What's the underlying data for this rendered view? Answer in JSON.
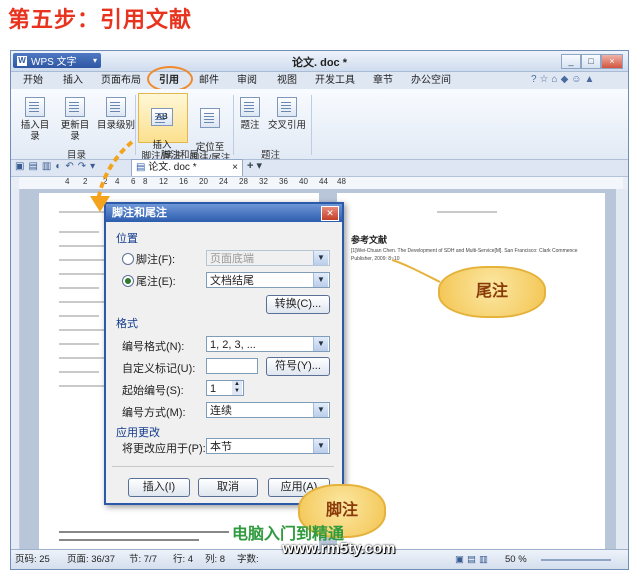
{
  "page_title": "第五步：引用文献",
  "window": {
    "app_button": "WPS 文字",
    "doc_title": "论文. doc *",
    "controls": [
      "_",
      "□",
      "×"
    ]
  },
  "menu_tabs": [
    "开始",
    "插入",
    "页面布局",
    "引用",
    "邮件",
    "审阅",
    "视图",
    "开发工具",
    "章节",
    "办公空间"
  ],
  "ribbon": {
    "buttons": [
      {
        "label": "插入目录",
        "icon": "insert-toc-icon"
      },
      {
        "label": "更新目录",
        "icon": "update-toc-icon"
      },
      {
        "label": "目录级别",
        "icon": "toc-level-icon"
      },
      {
        "label": "插入\n脚注/尾注",
        "icon": "insert-footnote-icon"
      },
      {
        "label": "定位至\n脚注/尾注",
        "icon": "goto-footnote-icon"
      },
      {
        "label": "题注",
        "icon": "caption-icon"
      },
      {
        "label": "交叉引用",
        "icon": "cross-ref-icon"
      }
    ],
    "groups": [
      "目录",
      "脚注和尾注",
      "题注"
    ]
  },
  "doc_tab": "论文. doc *",
  "ruler_ticks": [
    "4",
    "2",
    "2",
    "4",
    "6",
    "8",
    "12",
    "16",
    "20",
    "24",
    "28",
    "32",
    "36",
    "40",
    "44",
    "48"
  ],
  "page2": {
    "heading": "参考文献",
    "ref_text": "[1]Wei-Chuan Chen. The Development of SDH and Multi-Service[M]. San Francisco: Clark Commence Publisher, 2009: 8~10"
  },
  "dialog": {
    "title": "脚注和尾注",
    "section_position": "位置",
    "footnote_label": "脚注(F):",
    "footnote_value": "页面底端",
    "endnote_label": "尾注(E):",
    "endnote_value": "文档结尾",
    "convert_button": "转换(C)...",
    "section_format": "格式",
    "number_format_label": "编号格式(N):",
    "number_format_value": "1, 2, 3, ...",
    "custom_mark_label": "自定义标记(U):",
    "custom_mark_value": "",
    "symbol_button": "符号(Y)...",
    "start_at_label": "起始编号(S):",
    "start_at_value": "1",
    "numbering_label": "编号方式(M):",
    "numbering_value": "连续",
    "section_apply": "应用更改",
    "apply_to_label": "将更改应用于(P):",
    "apply_to_value": "本节",
    "insert_button": "插入(I)",
    "cancel_button": "取消",
    "apply_button": "应用(A)"
  },
  "callouts": {
    "endnote": "尾注",
    "footnote": "脚注"
  },
  "status": {
    "page": "页码: 25",
    "pages": "页面: 36/37",
    "section": "节: 7/7",
    "row": "行: 4",
    "col": "列: 8",
    "chars": "字数:",
    "zoom": "50 %"
  },
  "watermark": {
    "line1": "电脑入门到精通",
    "line2": "www.rm5ty.com"
  }
}
